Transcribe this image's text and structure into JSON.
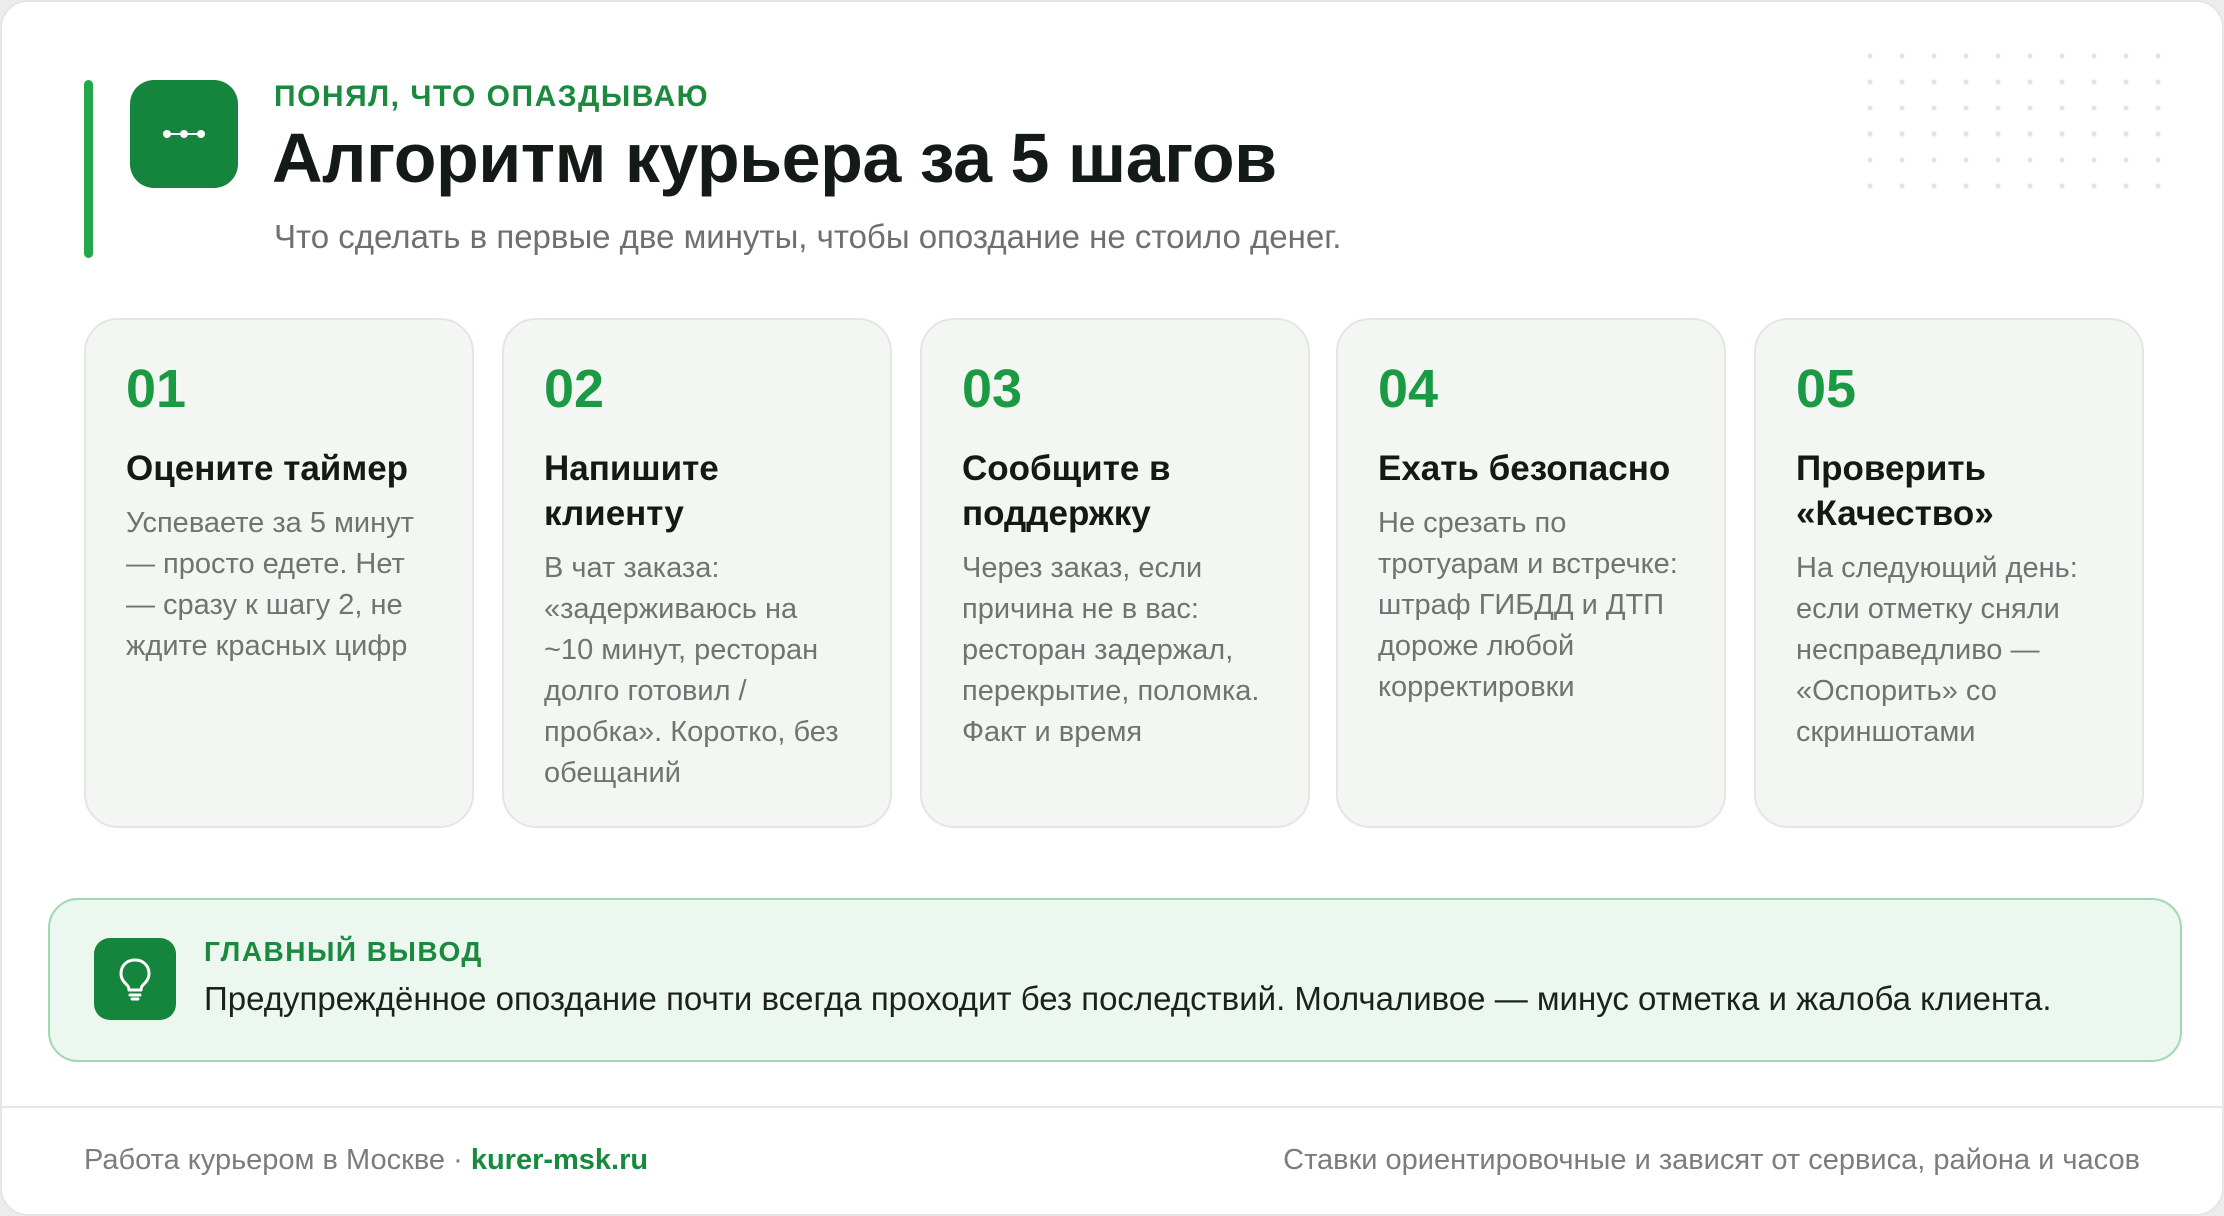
{
  "header": {
    "eyebrow": "ПОНЯЛ, ЧТО ОПАЗДЫВАЮ",
    "title": "Алгоритм курьера за 5 шагов",
    "subtitle": "Что сделать в первые две минуты, чтобы опоздание не стоило денег.",
    "logo_icon": "route-dots-icon"
  },
  "steps": [
    {
      "number": "01",
      "title": "Оцените таймер",
      "body": "Успеваете за 5 минут — просто едете. Нет — сразу к шагу 2, не ждите красных цифр"
    },
    {
      "number": "02",
      "title": "Напишите клиенту",
      "body": "В чат заказа: «задерживаюсь на ~10 минут, ресторан долго готовил / пробка». Коротко, без обещаний"
    },
    {
      "number": "03",
      "title": "Сообщите в поддержку",
      "body": "Через заказ, если причина не в вас: ресторан задержал, перекрытие, поломка. Факт и время"
    },
    {
      "number": "04",
      "title": "Ехать безопасно",
      "body": "Не срезать по тротуарам и встречке: штраф ГИБДД и ДТП дороже любой корректировки"
    },
    {
      "number": "05",
      "title": "Проверить «Качество»",
      "body": "На следующий день: если отметку сняли несправедливо — «Оспорить» со скриншотами"
    }
  ],
  "takeaway": {
    "label": "ГЛАВНЫЙ ВЫВОД",
    "text": "Предупреждённое опоздание почти всегда проходит без последствий. Молчаливое — минус отметка и жалоба клиента.",
    "icon": "lightbulb-icon"
  },
  "footer": {
    "left_text": "Работа курьером в Москве · ",
    "link": "kurer-msk.ru",
    "right_text": "Ставки ориентировочные и зависят от сервиса, района и часов"
  },
  "colors": {
    "accent": "#1b9a44",
    "accent_dark": "#15843c",
    "takeaway_bg": "#ecf7ef",
    "takeaway_border": "#9fd9b1"
  }
}
